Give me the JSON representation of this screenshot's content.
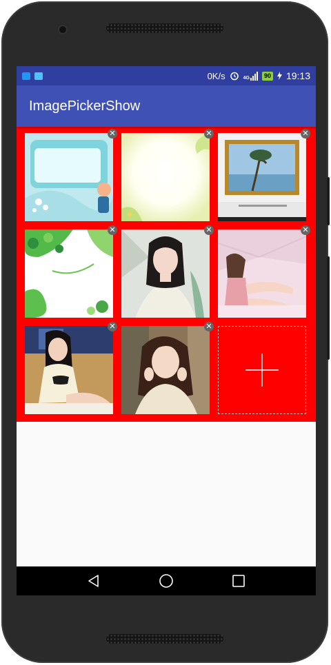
{
  "status_bar": {
    "speed": "0K/s",
    "network": "4G",
    "battery": "90",
    "time": "19:13",
    "colors": {
      "bar": "#303f9f",
      "battery": "#8cd13c"
    }
  },
  "app_bar": {
    "title": "ImagePickerShow",
    "color": "#3f51b5"
  },
  "image_grid": {
    "background": "#ff0000",
    "images": [
      {
        "name": "cartoon-sky-image"
      },
      {
        "name": "flower-frame-image"
      },
      {
        "name": "framed-painting-image"
      },
      {
        "name": "green-leaves-image"
      },
      {
        "name": "girl-white-dress-image"
      },
      {
        "name": "girl-pink-room-image"
      },
      {
        "name": "girl-sitting-image"
      },
      {
        "name": "girl-portrait-image"
      }
    ],
    "delete_glyph": "✕",
    "add_icon": "plus-icon"
  },
  "nav_bar": {
    "buttons": [
      "back-icon",
      "home-icon",
      "recents-icon"
    ]
  }
}
